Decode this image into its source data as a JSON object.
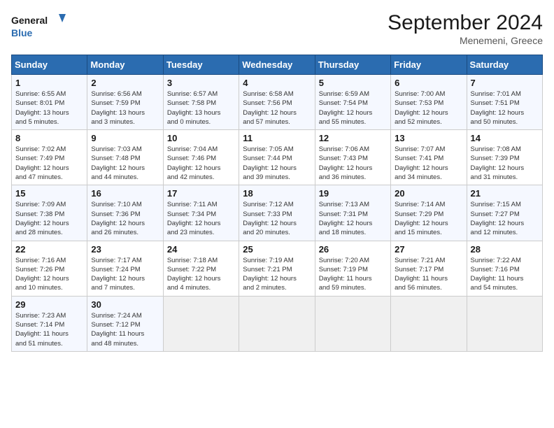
{
  "header": {
    "logo_line1": "General",
    "logo_line2": "Blue",
    "month": "September 2024",
    "location": "Menemeni, Greece"
  },
  "columns": [
    "Sunday",
    "Monday",
    "Tuesday",
    "Wednesday",
    "Thursday",
    "Friday",
    "Saturday"
  ],
  "weeks": [
    [
      {
        "day": "1",
        "info": "Sunrise: 6:55 AM\nSunset: 8:01 PM\nDaylight: 13 hours\nand 5 minutes."
      },
      {
        "day": "2",
        "info": "Sunrise: 6:56 AM\nSunset: 7:59 PM\nDaylight: 13 hours\nand 3 minutes."
      },
      {
        "day": "3",
        "info": "Sunrise: 6:57 AM\nSunset: 7:58 PM\nDaylight: 13 hours\nand 0 minutes."
      },
      {
        "day": "4",
        "info": "Sunrise: 6:58 AM\nSunset: 7:56 PM\nDaylight: 12 hours\nand 57 minutes."
      },
      {
        "day": "5",
        "info": "Sunrise: 6:59 AM\nSunset: 7:54 PM\nDaylight: 12 hours\nand 55 minutes."
      },
      {
        "day": "6",
        "info": "Sunrise: 7:00 AM\nSunset: 7:53 PM\nDaylight: 12 hours\nand 52 minutes."
      },
      {
        "day": "7",
        "info": "Sunrise: 7:01 AM\nSunset: 7:51 PM\nDaylight: 12 hours\nand 50 minutes."
      }
    ],
    [
      {
        "day": "8",
        "info": "Sunrise: 7:02 AM\nSunset: 7:49 PM\nDaylight: 12 hours\nand 47 minutes."
      },
      {
        "day": "9",
        "info": "Sunrise: 7:03 AM\nSunset: 7:48 PM\nDaylight: 12 hours\nand 44 minutes."
      },
      {
        "day": "10",
        "info": "Sunrise: 7:04 AM\nSunset: 7:46 PM\nDaylight: 12 hours\nand 42 minutes."
      },
      {
        "day": "11",
        "info": "Sunrise: 7:05 AM\nSunset: 7:44 PM\nDaylight: 12 hours\nand 39 minutes."
      },
      {
        "day": "12",
        "info": "Sunrise: 7:06 AM\nSunset: 7:43 PM\nDaylight: 12 hours\nand 36 minutes."
      },
      {
        "day": "13",
        "info": "Sunrise: 7:07 AM\nSunset: 7:41 PM\nDaylight: 12 hours\nand 34 minutes."
      },
      {
        "day": "14",
        "info": "Sunrise: 7:08 AM\nSunset: 7:39 PM\nDaylight: 12 hours\nand 31 minutes."
      }
    ],
    [
      {
        "day": "15",
        "info": "Sunrise: 7:09 AM\nSunset: 7:38 PM\nDaylight: 12 hours\nand 28 minutes."
      },
      {
        "day": "16",
        "info": "Sunrise: 7:10 AM\nSunset: 7:36 PM\nDaylight: 12 hours\nand 26 minutes."
      },
      {
        "day": "17",
        "info": "Sunrise: 7:11 AM\nSunset: 7:34 PM\nDaylight: 12 hours\nand 23 minutes."
      },
      {
        "day": "18",
        "info": "Sunrise: 7:12 AM\nSunset: 7:33 PM\nDaylight: 12 hours\nand 20 minutes."
      },
      {
        "day": "19",
        "info": "Sunrise: 7:13 AM\nSunset: 7:31 PM\nDaylight: 12 hours\nand 18 minutes."
      },
      {
        "day": "20",
        "info": "Sunrise: 7:14 AM\nSunset: 7:29 PM\nDaylight: 12 hours\nand 15 minutes."
      },
      {
        "day": "21",
        "info": "Sunrise: 7:15 AM\nSunset: 7:27 PM\nDaylight: 12 hours\nand 12 minutes."
      }
    ],
    [
      {
        "day": "22",
        "info": "Sunrise: 7:16 AM\nSunset: 7:26 PM\nDaylight: 12 hours\nand 10 minutes."
      },
      {
        "day": "23",
        "info": "Sunrise: 7:17 AM\nSunset: 7:24 PM\nDaylight: 12 hours\nand 7 minutes."
      },
      {
        "day": "24",
        "info": "Sunrise: 7:18 AM\nSunset: 7:22 PM\nDaylight: 12 hours\nand 4 minutes."
      },
      {
        "day": "25",
        "info": "Sunrise: 7:19 AM\nSunset: 7:21 PM\nDaylight: 12 hours\nand 2 minutes."
      },
      {
        "day": "26",
        "info": "Sunrise: 7:20 AM\nSunset: 7:19 PM\nDaylight: 11 hours\nand 59 minutes."
      },
      {
        "day": "27",
        "info": "Sunrise: 7:21 AM\nSunset: 7:17 PM\nDaylight: 11 hours\nand 56 minutes."
      },
      {
        "day": "28",
        "info": "Sunrise: 7:22 AM\nSunset: 7:16 PM\nDaylight: 11 hours\nand 54 minutes."
      }
    ],
    [
      {
        "day": "29",
        "info": "Sunrise: 7:23 AM\nSunset: 7:14 PM\nDaylight: 11 hours\nand 51 minutes."
      },
      {
        "day": "30",
        "info": "Sunrise: 7:24 AM\nSunset: 7:12 PM\nDaylight: 11 hours\nand 48 minutes."
      },
      {
        "day": "",
        "info": ""
      },
      {
        "day": "",
        "info": ""
      },
      {
        "day": "",
        "info": ""
      },
      {
        "day": "",
        "info": ""
      },
      {
        "day": "",
        "info": ""
      }
    ]
  ]
}
